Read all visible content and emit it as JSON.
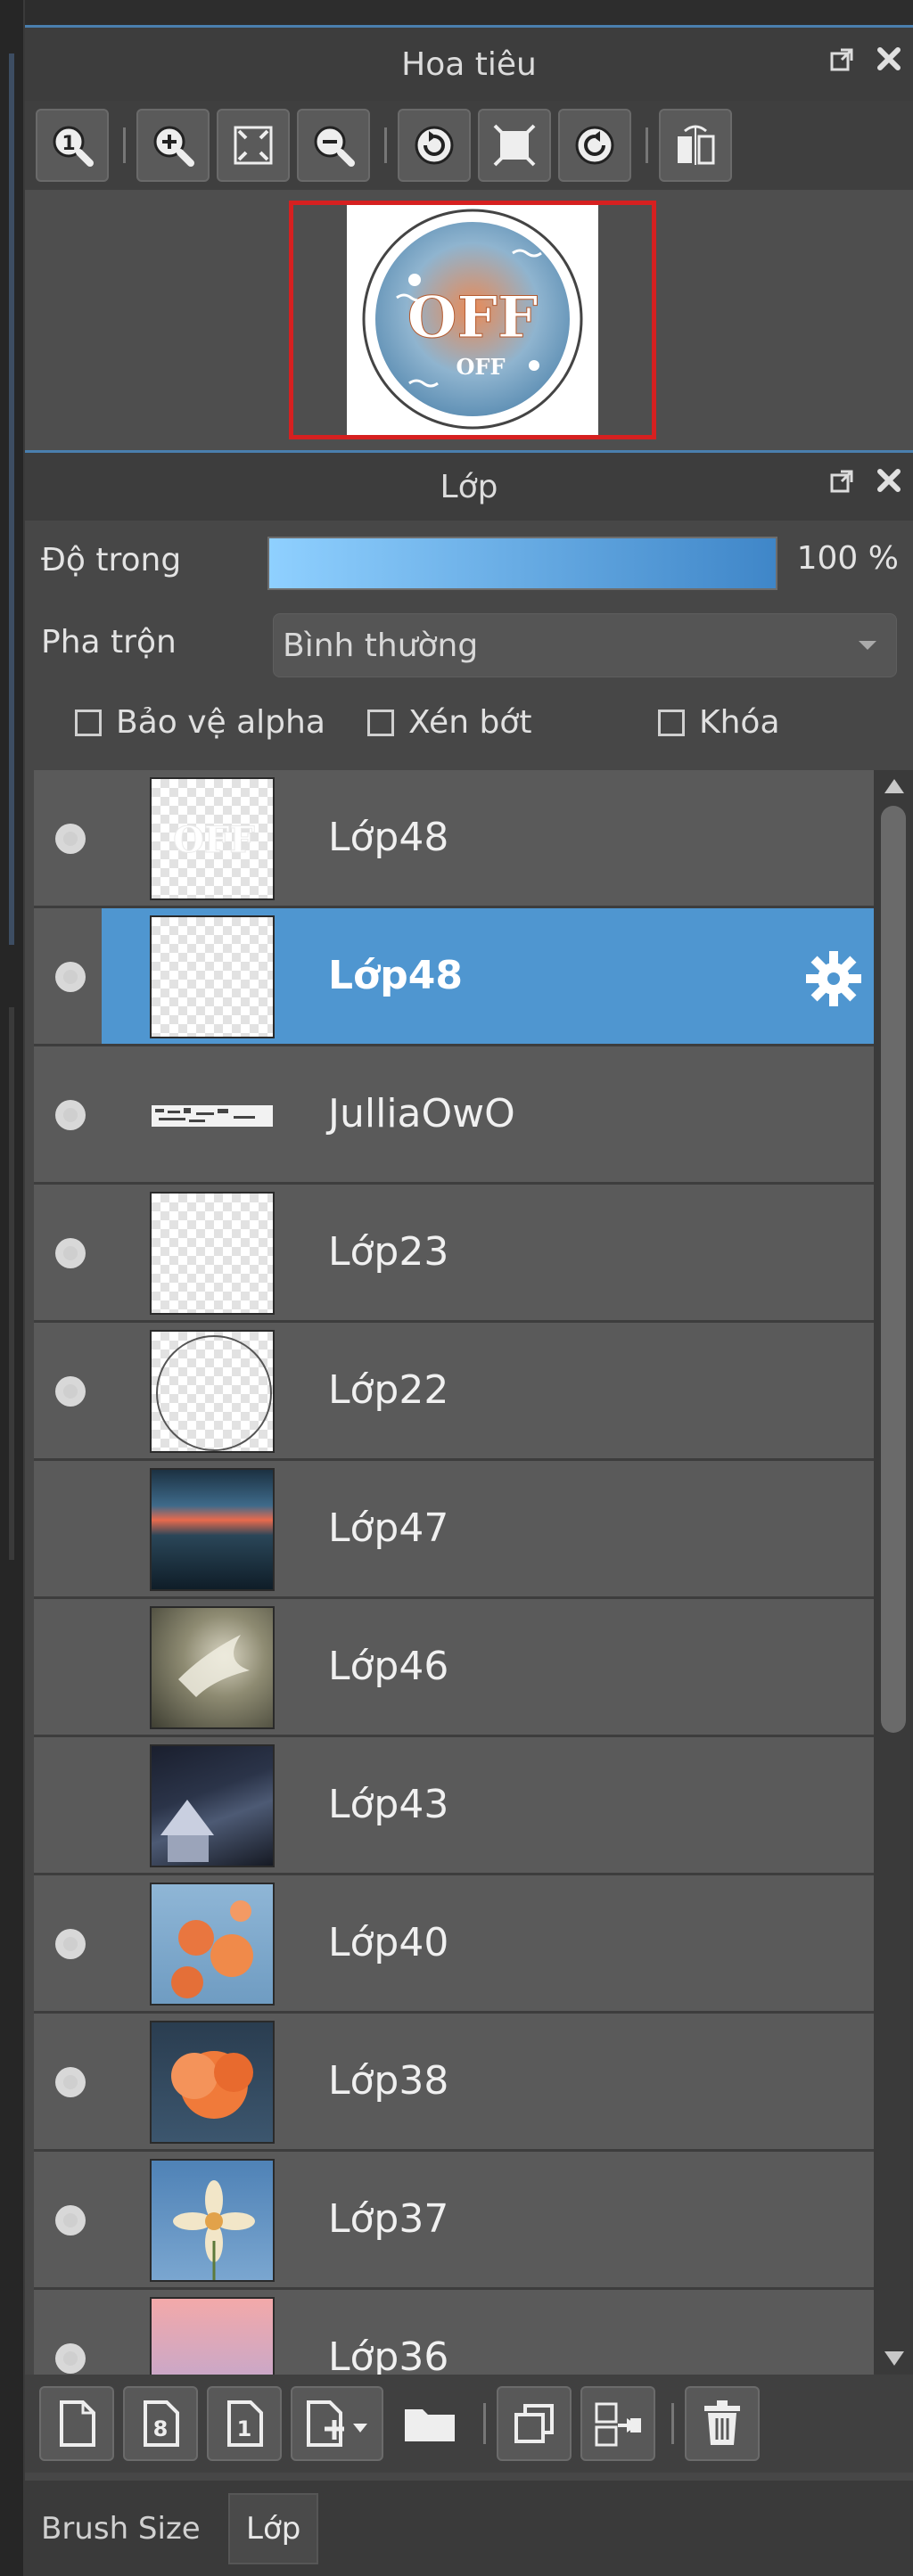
{
  "navigator": {
    "title": "Hoa tiêu",
    "header_icons": [
      "popout-icon",
      "close-icon"
    ],
    "toolbar_icons": [
      "zoom-actual-icon",
      "zoom-in-icon",
      "fit-screen-icon",
      "zoom-out-icon",
      "rotate-left-icon",
      "fit-frame-icon",
      "rotate-right-icon",
      "flip-horizontal-icon"
    ],
    "preview_text_1": "OFF",
    "preview_text_2": "OFF"
  },
  "layers_panel": {
    "title": "Lớp",
    "opacity_label": "Độ trong",
    "opacity_value": "100 %",
    "opacity_fraction": 1.0,
    "blend_label": "Pha trộn",
    "blend_value": "Bình thường",
    "protect_alpha_label": "Bảo vệ alpha",
    "clipping_label": "Xén bớt",
    "lock_label": "Khóa",
    "layers": [
      {
        "name": "Lớp48",
        "visible": true,
        "selected": false,
        "thumb": "text-transparent"
      },
      {
        "name": "Lớp48",
        "visible": true,
        "selected": true,
        "thumb": "transparent"
      },
      {
        "name": "JulliaOwO",
        "visible": true,
        "selected": false,
        "thumb": "watermark"
      },
      {
        "name": "Lớp23",
        "visible": true,
        "selected": false,
        "thumb": "transparent"
      },
      {
        "name": "Lớp22",
        "visible": true,
        "selected": false,
        "thumb": "circle"
      },
      {
        "name": "Lớp47",
        "visible": false,
        "selected": false,
        "thumb": "sunset-lake"
      },
      {
        "name": "Lớp46",
        "visible": false,
        "selected": false,
        "thumb": "bird-photo"
      },
      {
        "name": "Lớp43",
        "visible": false,
        "selected": false,
        "thumb": "house-night"
      },
      {
        "name": "Lớp40",
        "visible": true,
        "selected": false,
        "thumb": "orange-flowers"
      },
      {
        "name": "Lớp38",
        "visible": true,
        "selected": false,
        "thumb": "orange-cloud"
      },
      {
        "name": "Lớp37",
        "visible": true,
        "selected": false,
        "thumb": "daisy-sky"
      },
      {
        "name": "Lớp36",
        "visible": true,
        "selected": false,
        "thumb": "pink-sky"
      }
    ],
    "bottom_icons": [
      "new-layer-icon",
      "new-8bit-layer-icon",
      "new-1bit-layer-icon",
      "add-layer-menu-icon",
      "folder-icon",
      "duplicate-layer-icon",
      "merge-down-icon",
      "delete-icon"
    ]
  },
  "tabs": {
    "brush_size": "Brush Size",
    "layer": "Lớp"
  }
}
